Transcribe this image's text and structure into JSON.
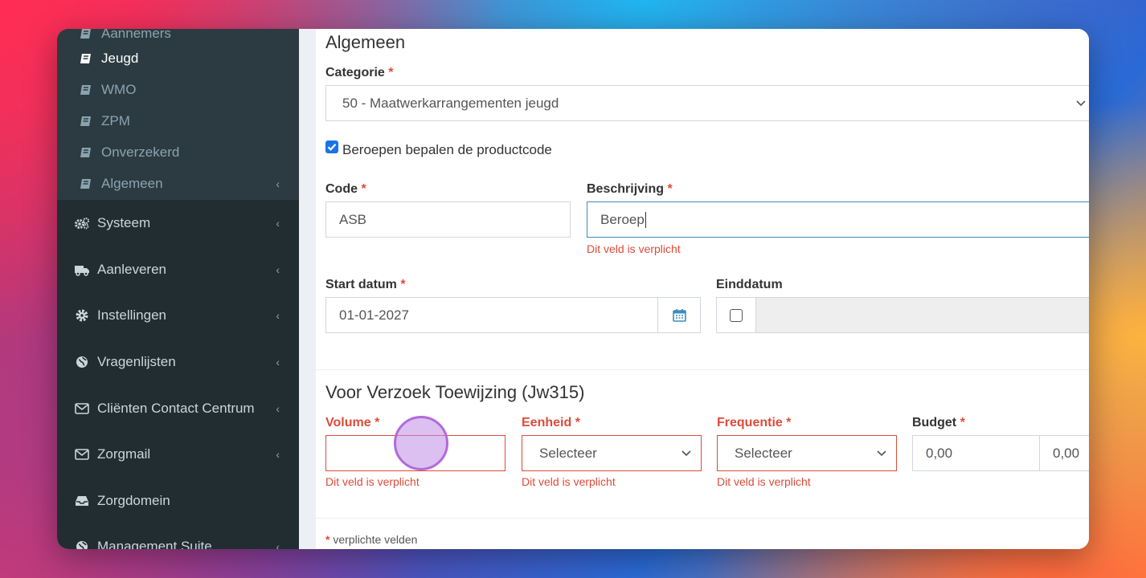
{
  "sidebar": {
    "sub_items": [
      {
        "label": "Aannemers",
        "icon": "book-icon"
      },
      {
        "label": "Jeugd",
        "icon": "book-icon",
        "active": true
      },
      {
        "label": "WMO",
        "icon": "book-icon"
      },
      {
        "label": "ZPM",
        "icon": "book-icon"
      },
      {
        "label": "Onverzekerd",
        "icon": "book-icon"
      },
      {
        "label": "Algemeen",
        "icon": "book-icon"
      }
    ],
    "items": [
      {
        "label": "Systeem",
        "icon": "gears-icon"
      },
      {
        "label": "Aanleveren",
        "icon": "truck-icon"
      },
      {
        "label": "Instellingen",
        "icon": "cog-icon"
      },
      {
        "label": "Vragenlijsten",
        "icon": "globe-icon"
      },
      {
        "label": "Cliënten Contact Centrum",
        "icon": "envelope-icon"
      },
      {
        "label": "Zorgmail",
        "icon": "envelope-icon"
      },
      {
        "label": "Zorgdomein",
        "icon": "inbox-icon"
      },
      {
        "label": "Management Suite",
        "icon": "globe-icon"
      }
    ],
    "chevron": "‹"
  },
  "form": {
    "section_title": "Algemeen",
    "categorie_label": "Categorie",
    "categorie_value": "50 - Maatwerkarrangementen jeugd",
    "beroepen_checkbox_label": "Beroepen bepalen de productcode",
    "beroepen_checked": true,
    "code_label": "Code",
    "code_value": "ASB",
    "beschrijving_label": "Beschrijving",
    "beschrijving_value": "Beroep",
    "beschrijving_error": "Dit veld is verplicht",
    "start_label": "Start datum",
    "start_value": "01-01-2027",
    "eind_label": "Einddatum",
    "required_mark": "*",
    "section2_title": "Voor Verzoek Toewijzing (Jw315)",
    "volume_label": "Volume",
    "volume_error": "Dit veld is verplicht",
    "eenheid_label": "Eenheid",
    "eenheid_value": "Selecteer",
    "eenheid_error": "Dit veld is verplicht",
    "frequentie_label": "Frequentie",
    "frequentie_value": "Selecteer",
    "frequentie_error": "Dit veld is verplicht",
    "budget_label": "Budget",
    "budget_value1": "0,00",
    "budget_value2": "0,00",
    "footnote_mark": "*",
    "footnote": "verplichte velden"
  },
  "colors": {
    "sidebar_bg": "#222d32",
    "error": "#dd4b39",
    "focus": "#3c8dbc",
    "checkbox": "#1a73e8"
  }
}
